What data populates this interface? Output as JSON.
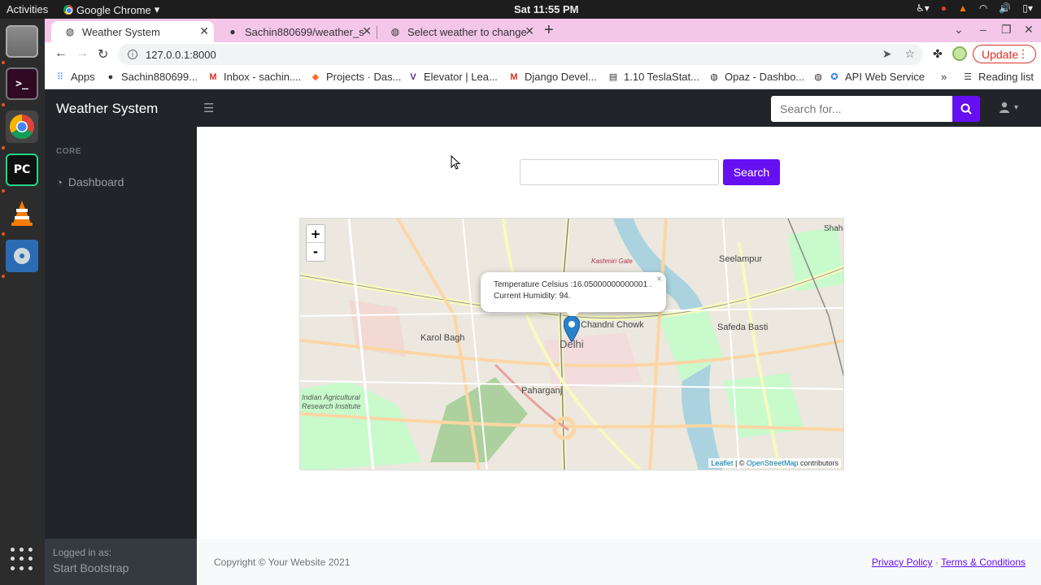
{
  "os": {
    "activities": "Activities",
    "app_name": "Google Chrome",
    "clock": "Sat 11:55 PM"
  },
  "browser": {
    "tabs": [
      {
        "label": "Weather System",
        "active": true
      },
      {
        "label": "Sachin880699/weather_s",
        "active": false
      },
      {
        "label": "Select weather to change",
        "active": false
      }
    ],
    "url": "127.0.0.1:8000",
    "update_label": "Update",
    "bookmarks": [
      {
        "label": "Apps",
        "icon": "apps-grid-icon"
      },
      {
        "label": "Sachin880699...",
        "icon": "github-icon"
      },
      {
        "label": "Inbox - sachin....",
        "icon": "gmail-icon"
      },
      {
        "label": "Projects · Das...",
        "icon": "gitlab-icon"
      },
      {
        "label": "Elevator | Lea...",
        "icon": "elevator-icon"
      },
      {
        "label": "Django Devel...",
        "icon": "gmail-icon"
      },
      {
        "label": "1.10 TeslaStat...",
        "icon": "calendar-icon"
      },
      {
        "label": "Opaz - Dashbo...",
        "icon": "globe-icon"
      },
      {
        "label": "API Web Service",
        "icon": "globe-icon"
      }
    ],
    "reading_list": "Reading list",
    "more_bookmarks": "»"
  },
  "app": {
    "brand": "Weather System",
    "top_search_placeholder": "Search for...",
    "sidebar": {
      "heading": "CORE",
      "items": [
        {
          "label": "Dashboard"
        }
      ],
      "footer_small": "Logged in as:",
      "footer_big": "Start Bootstrap"
    },
    "search": {
      "value": "",
      "button": "Search"
    },
    "map": {
      "popup_line1": "Temperature Celsius :16.05000000000001 .",
      "popup_line2": "Current Humidity: 94.",
      "zoom_in": "+",
      "zoom_out": "-",
      "attribution_leaflet": "Leaflet",
      "attribution_sep": " | © ",
      "attribution_osm": "OpenStreetMap",
      "attribution_tail": " contributors",
      "labels": {
        "seelampur": "Seelampur",
        "chandni_chowk": "Chandni Chowk",
        "delhi": "Delhi",
        "karol_bagh": "Karol Bagh",
        "safeda_basti": "Safeda Basti",
        "paharganj": "Paharganj",
        "kashmiri_gate": "Kashmiri Gate",
        "iari": "Indian Agricultural Research Institute",
        "shahdara": "Shahd"
      }
    },
    "footer": {
      "copyright": "Copyright © Your Website 2021",
      "privacy": "Privacy Policy",
      "separator": " · ",
      "terms": "Terms & Conditions"
    }
  },
  "colors": {
    "accent": "#6610f2",
    "sidebar_bg": "#212529",
    "tabstrip_bg": "#f4c6e8"
  }
}
